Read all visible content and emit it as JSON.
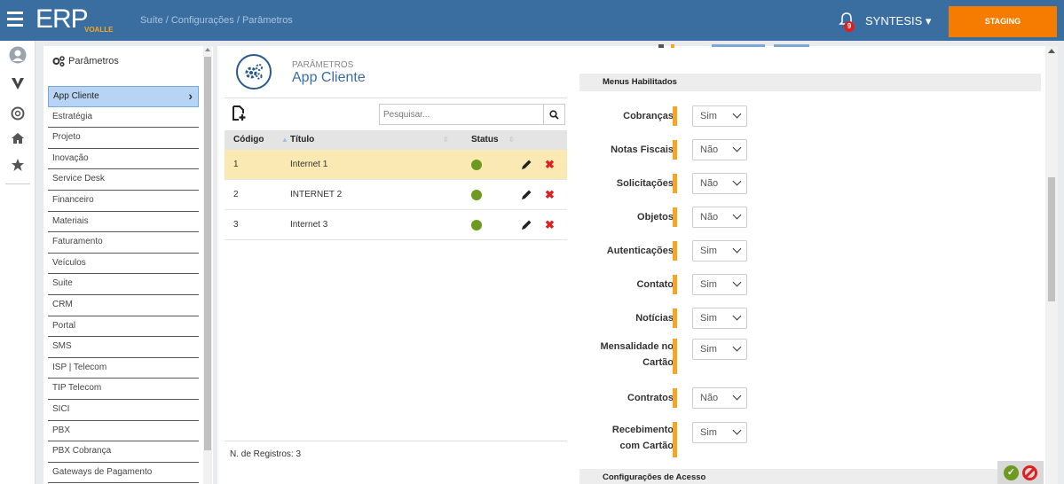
{
  "topbar": {
    "logo": "ERP",
    "logo_sub": "VOALLE",
    "breadcrumb": "Suíte  /  Configurações  /  Parâmetros",
    "notifications_count": "9",
    "user": "SYNTESIS ▾",
    "environment": "STAGING"
  },
  "rail": {
    "icons": [
      "avatar-icon",
      "voalle-logo-icon",
      "support-icon",
      "home-icon",
      "star-icon"
    ]
  },
  "menu": {
    "header": "Parâmetros",
    "items": [
      {
        "label": "App Cliente",
        "active": true
      },
      {
        "label": "Estratégia"
      },
      {
        "label": "Projeto"
      },
      {
        "label": "Inovação"
      },
      {
        "label": "Service Desk"
      },
      {
        "label": "Financeiro"
      },
      {
        "label": "Materiais"
      },
      {
        "label": "Faturamento"
      },
      {
        "label": "Veículos"
      },
      {
        "label": "Suite"
      },
      {
        "label": "CRM"
      },
      {
        "label": "Portal"
      },
      {
        "label": "SMS"
      },
      {
        "label": "ISP | Telecom"
      },
      {
        "label": "TIP Telecom"
      },
      {
        "label": "SICI"
      },
      {
        "label": "PBX"
      },
      {
        "label": "PBX Cobrança"
      },
      {
        "label": "Gateways de Pagamento"
      }
    ]
  },
  "page": {
    "subtitle": "PARÂMETROS",
    "title": "App Cliente"
  },
  "search": {
    "placeholder": "Pesquisar..."
  },
  "grid": {
    "columns": {
      "code": "Código",
      "title": "Título",
      "status": "Status"
    },
    "rows": [
      {
        "code": "1",
        "title": "Internet 1",
        "status": "active",
        "selected": true
      },
      {
        "code": "2",
        "title": "INTERNET 2",
        "status": "active"
      },
      {
        "code": "3",
        "title": "Internet 3",
        "status": "active"
      }
    ],
    "records_label": "N. de Registros: 3"
  },
  "form": {
    "menus_section": "Menus Habilitados",
    "access_section": "Configurações de Acesso",
    "fields": [
      {
        "label": "Cobranças",
        "value": "Sim"
      },
      {
        "label": "Notas Fiscais",
        "value": "Não"
      },
      {
        "label": "Solicitações",
        "value": "Não"
      },
      {
        "label": "Objetos",
        "value": "Não"
      },
      {
        "label": "Autenticações",
        "value": "Sim"
      },
      {
        "label": "Contato",
        "value": "Sim"
      },
      {
        "label": "Notícias",
        "value": "Sim"
      },
      {
        "label": "Mensalidade no Cartão",
        "value": "Sim"
      },
      {
        "label": "Contratos",
        "value": "Não"
      },
      {
        "label": "Recebimento com Cartão",
        "value": "Sim"
      }
    ]
  },
  "colors": {
    "topbar": "#3b6ea0",
    "staging": "#f57c00",
    "accent_bar": "#f5a623",
    "selected_row": "#fbe9b4",
    "status_ok": "#6b9a1e",
    "delete": "#e02020"
  }
}
